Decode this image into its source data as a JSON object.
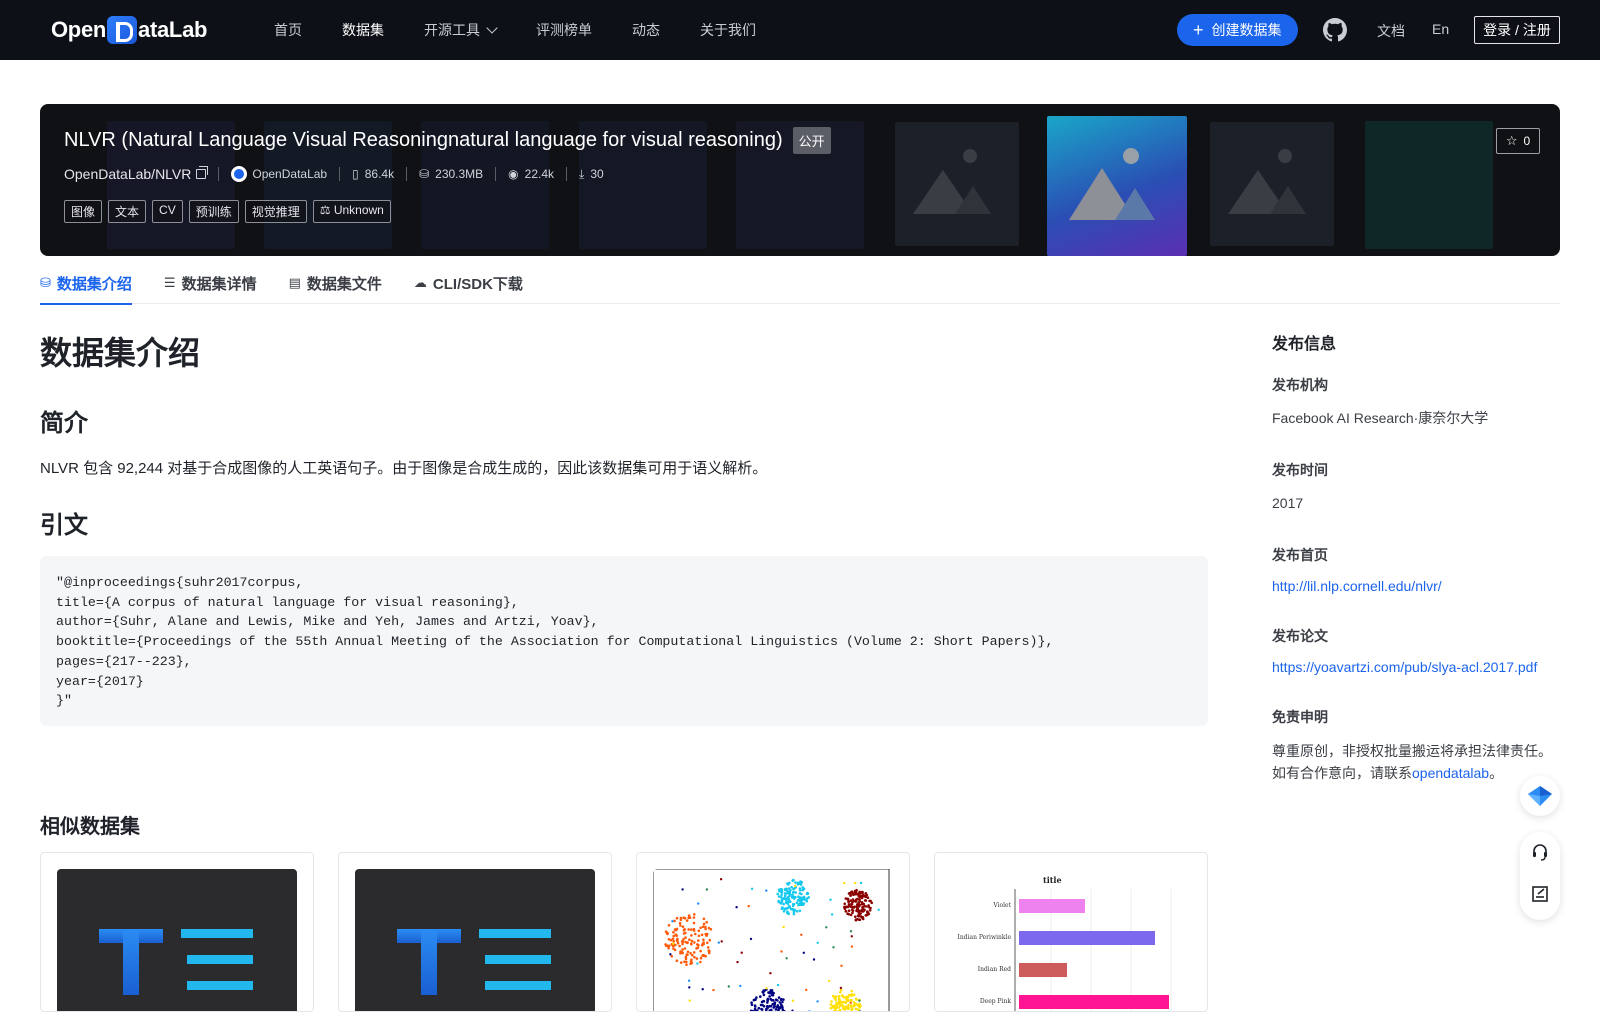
{
  "nav": {
    "logo_text_left": "Open",
    "logo_text_right": "ataLab",
    "items": [
      {
        "label": "首页",
        "active": false
      },
      {
        "label": "数据集",
        "active": true
      },
      {
        "label": "开源工具",
        "active": false,
        "dropdown": true
      },
      {
        "label": "评测榜单",
        "active": false
      },
      {
        "label": "动态",
        "active": false
      },
      {
        "label": "关于我们",
        "active": false
      }
    ],
    "create_label": "创建数据集",
    "docs_label": "文档",
    "lang_label": "En",
    "login_label": "登录 / 注册"
  },
  "dataset": {
    "title": "NLVR (Natural Language Visual Reasoningnatural language for visual reasoning)",
    "visibility": "公开",
    "star_count": "0",
    "repo": "OpenDataLab/NLVR",
    "publisher": "OpenDataLab",
    "files": "86.4k",
    "size": "230.3MB",
    "views": "22.4k",
    "downloads": "30",
    "tags": [
      "图像",
      "文本",
      "CV",
      "预训练",
      "视觉推理"
    ],
    "license": "Unknown"
  },
  "tabs": [
    {
      "label": "数据集介绍",
      "icon": "database-icon",
      "active": true
    },
    {
      "label": "数据集详情",
      "icon": "list-icon",
      "active": false
    },
    {
      "label": "数据集文件",
      "icon": "file-icon",
      "active": false
    },
    {
      "label": "CLI/SDK下载",
      "icon": "cloud-download-icon",
      "active": false
    }
  ],
  "content": {
    "heading": "数据集介绍",
    "intro_heading": "简介",
    "intro_text": "NLVR 包含 92,244 对基于合成图像的人工英语句子。由于图像是合成生成的，因此该数据集可用于语义解析。",
    "citation_heading": "引文",
    "citation": "\"@inproceedings{suhr2017corpus,\ntitle={A corpus of natural language for visual reasoning},\nauthor={Suhr, Alane and Lewis, Mike and Yeh, James and Artzi, Yoav},\nbooktitle={Proceedings of the 55th Annual Meeting of the Association for Computational Linguistics (Volume 2: Short Papers)},\npages={217--223},\nyear={2017}\n}\"",
    "similar_heading": "相似数据集"
  },
  "sidebar": {
    "title": "发布信息",
    "org_label": "发布机构",
    "org_value": "Facebook AI Research·康奈尔大学",
    "time_label": "发布时间",
    "time_value": "2017",
    "homepage_label": "发布首页",
    "homepage_value": "http://lil.nlp.cornell.edu/nlvr/",
    "paper_label": "发布论文",
    "paper_value": "https://yoavartzi.com/pub/slya-acl.2017.pdf",
    "disclaimer_label": "免责申明",
    "disclaimer_text": "尊重原创，非授权批量搬运将承担法律责任。如有合作意向，请联系",
    "disclaimer_link": "opendatalab",
    "disclaimer_end": "。"
  },
  "similar_charts": {
    "bar_title": "title",
    "bar_labels": [
      "Violet",
      "Indian Periwinkle",
      "Indian Red",
      "Deep Pink"
    ]
  },
  "colors": {
    "brand": "#1b64ec",
    "nav_bg": "#0d1117"
  }
}
